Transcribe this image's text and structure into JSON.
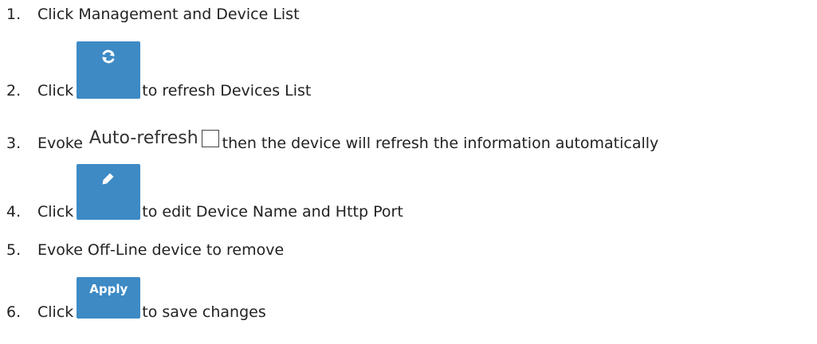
{
  "steps": [
    {
      "num": "1.",
      "text": "Click Management and Device List"
    },
    {
      "num": "2.",
      "pre": "Click",
      "post": "to refresh Devices List",
      "icon": "refresh-icon"
    },
    {
      "num": "3.",
      "pre": "Evoke",
      "control_label": "Auto-refresh",
      "post": "then the device will refresh the information automatically",
      "checked": false
    },
    {
      "num": "4.",
      "pre": "Click",
      "post": "to edit Device Name and Http Port",
      "icon": "pencil-icon"
    },
    {
      "num": "5.",
      "text": "Evoke Off-Line device to remove"
    },
    {
      "num": "6.",
      "pre": "Click",
      "button_label": "Apply",
      "post": "to save changes"
    }
  ],
  "colors": {
    "button": "#3d8ac5",
    "button_text": "#ffffff",
    "text": "#222222"
  }
}
